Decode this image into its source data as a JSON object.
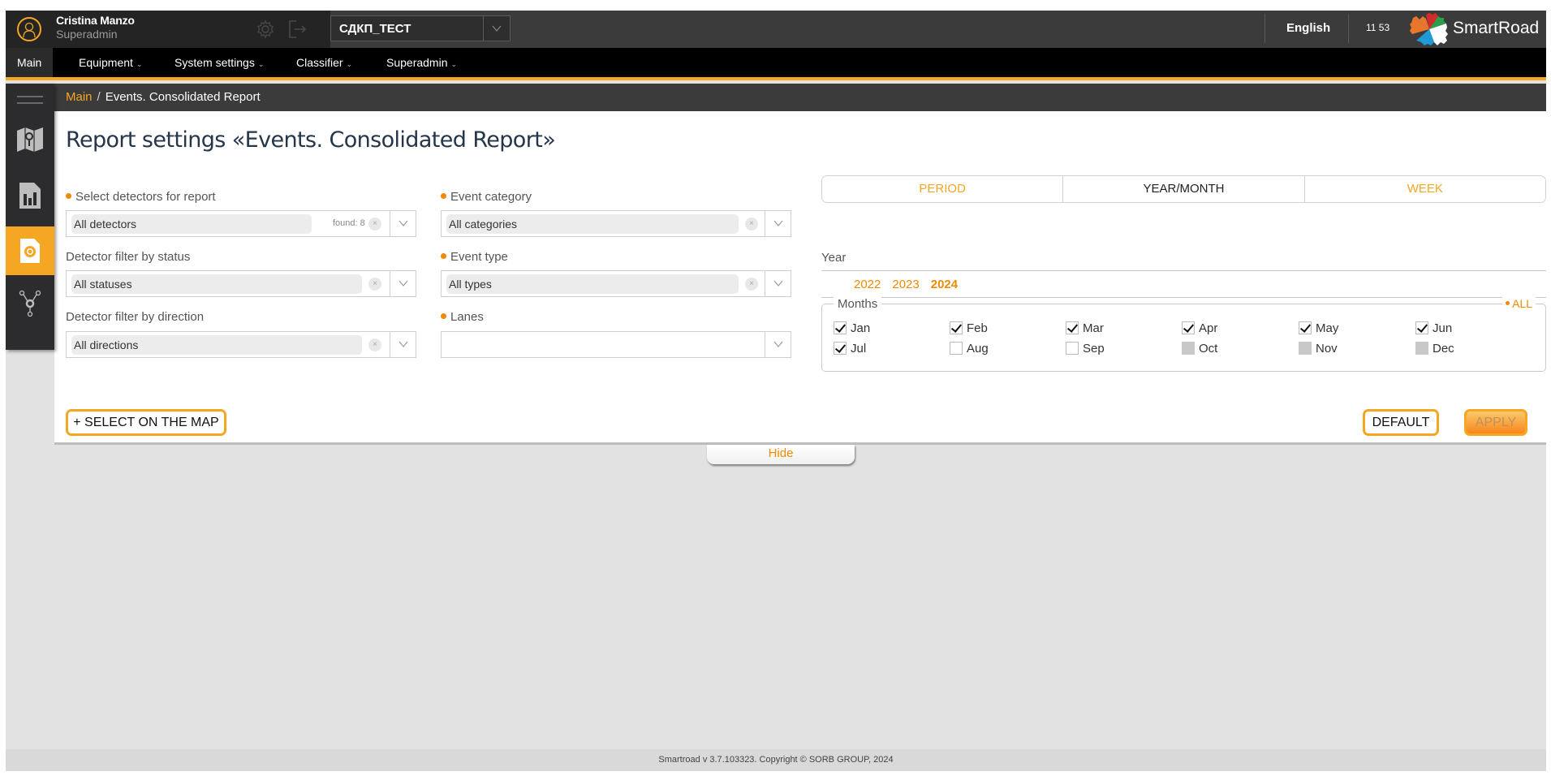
{
  "topbar": {
    "user_name": "Cristina Manzo",
    "user_role": "Superadmin",
    "project": "СДКП_ТЕСТ",
    "language": "English",
    "clock": "11 53",
    "brand": "SmartRoad"
  },
  "nav": {
    "items": [
      {
        "label": "Main",
        "active": true,
        "dropdown": false
      },
      {
        "label": "Equipment",
        "dropdown": true
      },
      {
        "label": "System settings",
        "dropdown": true
      },
      {
        "label": "Classifier",
        "dropdown": true
      },
      {
        "label": "Superadmin",
        "dropdown": true
      }
    ]
  },
  "breadcrumb": {
    "home": "Main",
    "separator": "/",
    "current": "Events. Consolidated Report"
  },
  "sidebar": {
    "items": [
      {
        "icon": "menu-icon"
      },
      {
        "icon": "map-icon"
      },
      {
        "icon": "chart-report-icon"
      },
      {
        "icon": "event-report-icon",
        "active": true
      },
      {
        "icon": "network-icon"
      }
    ]
  },
  "form": {
    "title": "Report settings «Events. Consolidated Report»",
    "detectors": {
      "label": "Select detectors for report",
      "required": true,
      "value": "All detectors",
      "found": "found: 8"
    },
    "status_filter": {
      "label": "Detector filter by status",
      "required": false,
      "value": "All statuses"
    },
    "direction_filter": {
      "label": "Detector filter by direction",
      "required": false,
      "value": "All directions"
    },
    "event_category": {
      "label": "Event category",
      "required": true,
      "value": "All categories"
    },
    "event_type": {
      "label": "Event type",
      "required": true,
      "value": "All types"
    },
    "lanes": {
      "label": "Lanes",
      "required": true,
      "value": ""
    },
    "clear_glyph": "×"
  },
  "period": {
    "tabs": [
      {
        "label": "PERIOD",
        "active": false
      },
      {
        "label": "YEAR/MONTH",
        "active": true
      },
      {
        "label": "WEEK",
        "active": false
      }
    ],
    "year_label": "Year",
    "years": [
      {
        "label": "2022",
        "selected": false
      },
      {
        "label": "2023",
        "selected": false
      },
      {
        "label": "2024",
        "selected": true
      }
    ],
    "months_label": "Months",
    "all_label": "ALL",
    "months": [
      {
        "label": "Jan",
        "state": "checked"
      },
      {
        "label": "Feb",
        "state": "checked"
      },
      {
        "label": "Mar",
        "state": "checked"
      },
      {
        "label": "Apr",
        "state": "checked"
      },
      {
        "label": "May",
        "state": "checked"
      },
      {
        "label": "Jun",
        "state": "checked"
      },
      {
        "label": "Jul",
        "state": "checked"
      },
      {
        "label": "Aug",
        "state": "unchecked"
      },
      {
        "label": "Sep",
        "state": "unchecked"
      },
      {
        "label": "Oct",
        "state": "disabled"
      },
      {
        "label": "Nov",
        "state": "disabled"
      },
      {
        "label": "Dec",
        "state": "disabled"
      }
    ]
  },
  "buttons": {
    "select_on_map": "+ SELECT ON THE MAP",
    "default": "DEFAULT",
    "apply": "APPLY",
    "hide": "Hide"
  },
  "footer": {
    "text": "Smartroad v 3.7.103323. Copyright © SORB GROUP, 2024"
  },
  "colors": {
    "accent": "#f5a623",
    "accent_text": "#f08a00",
    "topbar": "#3b3b3b",
    "navbar": "#000000"
  }
}
